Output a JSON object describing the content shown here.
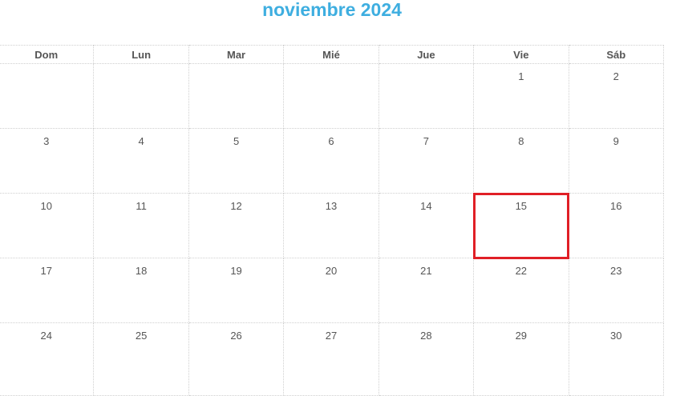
{
  "header": {
    "title": "noviembre 2024"
  },
  "calendar": {
    "weekdays": [
      "Dom",
      "Lun",
      "Mar",
      "Mié",
      "Jue",
      "Vie",
      "Sáb"
    ],
    "weeks": [
      [
        "",
        "",
        "",
        "",
        "",
        "1",
        "2"
      ],
      [
        "3",
        "4",
        "5",
        "6",
        "7",
        "8",
        "9"
      ],
      [
        "10",
        "11",
        "12",
        "13",
        "14",
        "15",
        "16"
      ],
      [
        "17",
        "18",
        "19",
        "20",
        "21",
        "22",
        "23"
      ],
      [
        "24",
        "25",
        "26",
        "27",
        "28",
        "29",
        "30"
      ]
    ],
    "highlighted_day": "15",
    "highlight_color": "#e01f26",
    "accent_color": "#3eaee0"
  }
}
